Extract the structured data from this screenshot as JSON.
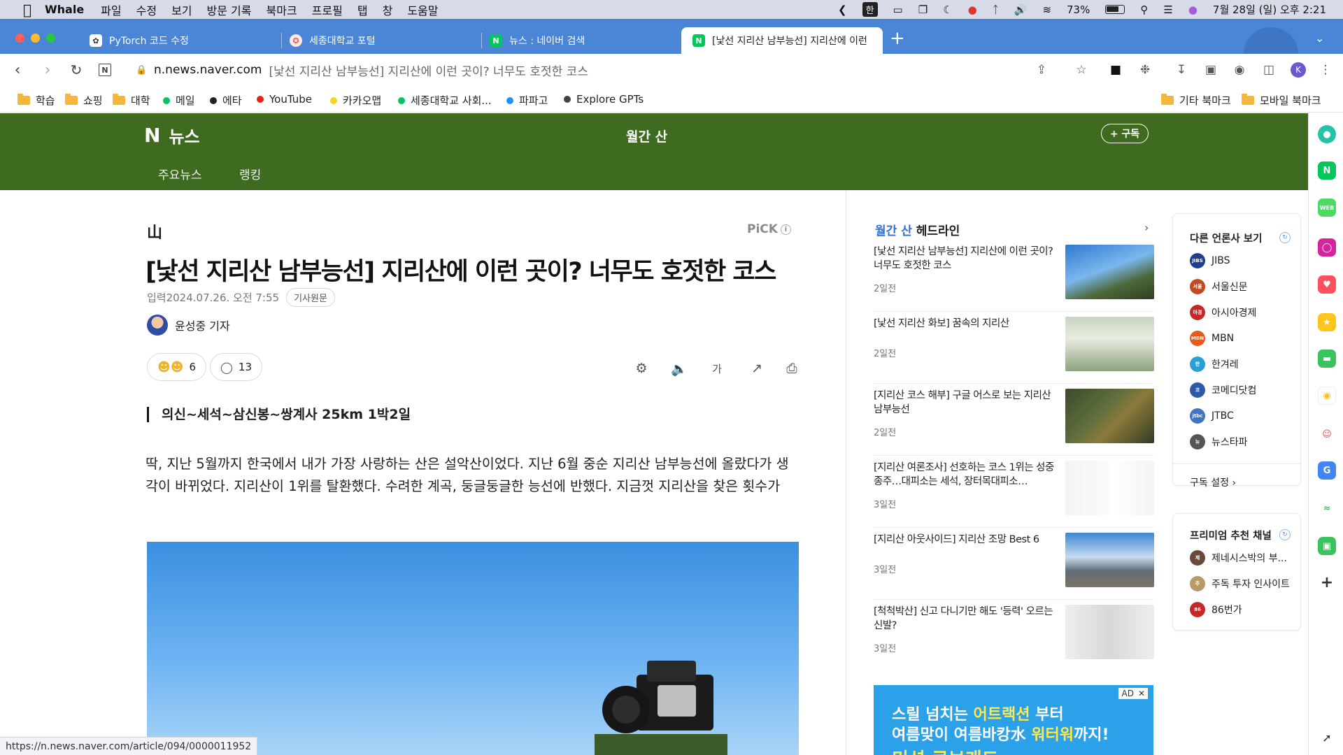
{
  "menubar": {
    "app": "Whale",
    "items": [
      "파일",
      "수정",
      "보기",
      "방문 기록",
      "북마크",
      "프로필",
      "탭",
      "창",
      "도움말"
    ],
    "input_mode": "한",
    "battery": "73%",
    "datetime": "7월 28일 (일) 오후 2:21"
  },
  "tabs": [
    {
      "title": "PyTorch 코드 수정",
      "favicon": "openai-icon",
      "color": "#ffffff"
    },
    {
      "title": "세종대학교 포털",
      "favicon": "sejong-icon",
      "color": "#e0584f"
    },
    {
      "title": "뉴스 : 네이버 검색",
      "favicon": "naver-icon",
      "color": "#03c75a"
    },
    {
      "title": "[낯선 지리산 남부능선] 지리산에 이런",
      "favicon": "naver-icon",
      "color": "#03c75a"
    }
  ],
  "address": {
    "domain": "n.news.naver.com",
    "path": "[낯선 지리산 남부능선] 지리산에 이런 곳이? 너무도 호젓한 코스",
    "profile_initial": "K"
  },
  "bookmarks": [
    {
      "label": "학습",
      "kind": "folder"
    },
    {
      "label": "쇼핑",
      "kind": "folder"
    },
    {
      "label": "대학",
      "kind": "folder"
    },
    {
      "label": "메일",
      "kind": "dot",
      "color": "#03c75a"
    },
    {
      "label": "에타",
      "kind": "dot",
      "color": "#222222"
    },
    {
      "label": "YouTube",
      "kind": "dot",
      "color": "#e62117"
    },
    {
      "label": "카카오맵",
      "kind": "dot",
      "color": "#f7d51d"
    },
    {
      "label": "세종대학교 사회...",
      "kind": "dot",
      "color": "#03c75a"
    },
    {
      "label": "파파고",
      "kind": "dot",
      "color": "#1e90ff"
    },
    {
      "label": "Explore GPTs",
      "kind": "dot",
      "color": "#444444"
    }
  ],
  "bookmarks_right": [
    {
      "label": "기타 북마크"
    },
    {
      "label": "모바일 북마크"
    }
  ],
  "naver_header": {
    "logo_n": "N",
    "logo_text": "뉴스",
    "press_title": "월간 산",
    "subscribe": "+ 구독",
    "nav": [
      "주요뉴스",
      "랭킹"
    ],
    "bg_color": "#3e6b1f"
  },
  "article": {
    "press_mark": "山",
    "pick": "PiCK",
    "headline": "[낯선 지리산 남부능선] 지리산에 이런 곳이? 너무도 호젓한 코스",
    "dateline": "입력2024.07.26. 오전 7:55",
    "original_button": "기사원문",
    "reporter": "윤성중 기자",
    "reactions": "6",
    "comments": "13",
    "subhead": "의신~세석~삼신봉~쌍계사 25km 1박2일",
    "body": "딱, 지난 5월까지 한국에서 내가 가장 사랑하는 산은 설악산이었다. 지난 6월 중순 지리산 남부능선에 올랐다가 생각이 바뀌었다. 지리산이 1위를 탈환했다. 수려한 계곡, 둥글둥글한 능선에 반했다. 지금껏 지리산을 찾은 횟수가"
  },
  "headlines": {
    "title_accent": "월간 산",
    "title_rest": " 헤드라인",
    "more": "›",
    "items": [
      {
        "title": "[낯선 지리산 남부능선] 지리산에 이런 곳이? 너무도 호젓한 코스",
        "ago": "2일전",
        "thumb": "linear-gradient(160deg,#2f79d1 0%,#7bb7ee 45%,#4d6a3a 70%,#2f3d22 100%)"
      },
      {
        "title": "[낯선 지리산 화보] 꿈속의 지리산",
        "ago": "2일전",
        "thumb": "linear-gradient(180deg,#c9d4c0 0%,#e7ebe1 40%,#8ea37e 100%)"
      },
      {
        "title": "[지리산 코스 해부] 구글 어스로 보는 지리산 남부능선",
        "ago": "2일전",
        "thumb": "linear-gradient(135deg,#3b4a2c 0%,#5f6e3c 40%,#8b7a3a 60%,#2f3a25 100%)"
      },
      {
        "title": "[지리산 여론조사] 선호하는 코스 1위는 성중종주…대피소는 세석, 장터목대피소…",
        "ago": "3일전",
        "thumb": "linear-gradient(90deg,#f4f4f4 0%,#fafafa 48%,#ffffff 52%,#f4f4f4 100%)"
      },
      {
        "title": "[지리산 아웃사이드] 지리산 조망 Best 6",
        "ago": "3일전",
        "thumb": "linear-gradient(180deg,#3c86d2 0%,#c7dcf0 45%,#5f6d78 70%,#7c7462 100%)"
      },
      {
        "title": "[척척박산] 신고 다니기만 해도 '등력' 오르는 신발?",
        "ago": "3일전",
        "thumb": "linear-gradient(90deg,#eeeeee 0%,#d8d8d8 50%,#eeeeee 100%)"
      }
    ]
  },
  "ad": {
    "badge": "AD",
    "line1_a": "스릴 넘치는 ",
    "line1_b": "어트랙션",
    "line1_c": " 부터",
    "line2_a": "여름맞이 여름바캉水 ",
    "line2_b": "워터워",
    "line2_c": "까지!",
    "line3": "미션 큐브캐드"
  },
  "press_panel": {
    "title": "다른 언론사 보기",
    "outlets": [
      {
        "name": "JIBS",
        "color": "#1e3f8f",
        "logo": "JIBS"
      },
      {
        "name": "서울신문",
        "color": "#c24a1d",
        "logo": "서울"
      },
      {
        "name": "아시아경제",
        "color": "#c62828",
        "logo": "아경"
      },
      {
        "name": "MBN",
        "color": "#e65a1d",
        "logo": "MBN"
      },
      {
        "name": "한겨레",
        "color": "#2a9fd6",
        "logo": "한"
      },
      {
        "name": "코메디닷컴",
        "color": "#2d5aa8",
        "logo": "코"
      },
      {
        "name": "JTBC",
        "color": "#3f74c4",
        "logo": "jtbc"
      },
      {
        "name": "뉴스타파",
        "color": "#555555",
        "logo": "뉴"
      }
    ],
    "settings": "구독 설정 ›",
    "premium_title": "프리미엄 추천 채널",
    "premium": [
      {
        "name": "제네시스박의 부...",
        "color": "#6a4a3a",
        "logo": "제"
      },
      {
        "name": "주독 투자 인사이트",
        "color": "#b79a6a",
        "logo": "주"
      },
      {
        "name": "86번가",
        "color": "#c62828",
        "logo": "86"
      }
    ]
  },
  "status_url": "https://n.news.naver.com/article/094/0000011952"
}
